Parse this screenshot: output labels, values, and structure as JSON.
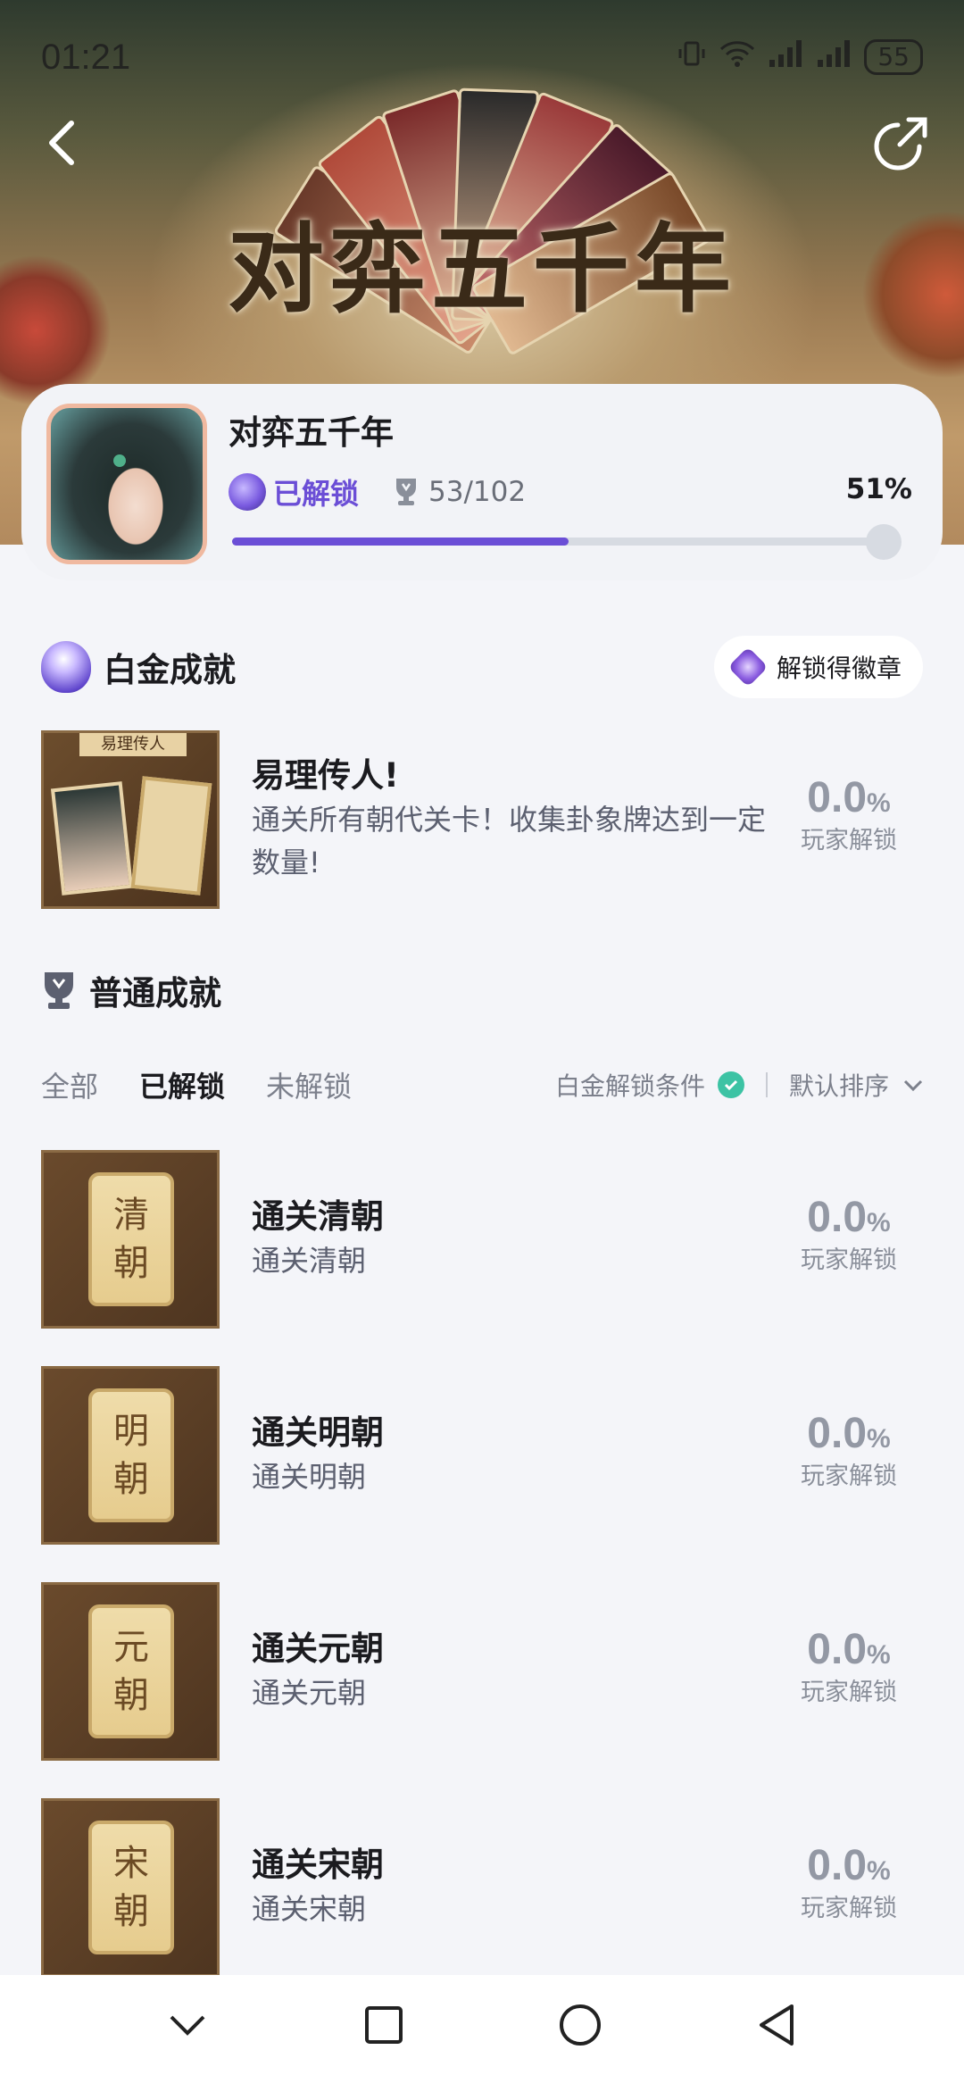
{
  "status_bar": {
    "time": "01:21",
    "battery": "55"
  },
  "hero": {
    "title": "对弈五千年"
  },
  "game": {
    "title": "对弈五千年",
    "unlocked_label": "已解锁",
    "trophy_count": "53/102",
    "percent_label": "51%",
    "progress": 0.51
  },
  "platinum": {
    "section_title": "白金成就",
    "badge_pill": "解锁得徽章",
    "thumb_banner": "易理传人",
    "item": {
      "name": "易理传人!",
      "desc": "通关所有朝代关卡！收集卦象牌达到一定数量!",
      "rate_value": "0.0",
      "rate_unit": "%",
      "rate_label": "玩家解锁"
    }
  },
  "common": {
    "section_title": "普通成就",
    "tabs": [
      {
        "label": "全部"
      },
      {
        "label": "已解锁"
      },
      {
        "label": "未解锁"
      }
    ],
    "filter_condition": "白金解锁条件",
    "sort_label": "默认排序",
    "items": [
      {
        "tablet": [
          "清",
          "朝"
        ],
        "name": "通关清朝",
        "desc": "通关清朝",
        "rate_value": "0.0",
        "rate_unit": "%",
        "rate_label": "玩家解锁"
      },
      {
        "tablet": [
          "明",
          "朝"
        ],
        "name": "通关明朝",
        "desc": "通关明朝",
        "rate_value": "0.0",
        "rate_unit": "%",
        "rate_label": "玩家解锁"
      },
      {
        "tablet": [
          "元",
          "朝"
        ],
        "name": "通关元朝",
        "desc": "通关元朝",
        "rate_value": "0.0",
        "rate_unit": "%",
        "rate_label": "玩家解锁"
      },
      {
        "tablet": [
          "宋",
          "朝"
        ],
        "name": "通关宋朝",
        "desc": "通关宋朝",
        "rate_value": "0.0",
        "rate_unit": "%",
        "rate_label": "玩家解锁"
      }
    ]
  },
  "colors": {
    "accent": "#6b4ed6",
    "check": "#3cc3a4",
    "page_bg": "#f4f5f9"
  },
  "icons": [
    "back-icon",
    "share-icon",
    "platinum-trophy-icon",
    "trophy-icon",
    "badge-icon",
    "check-icon",
    "chevron-down-icon"
  ]
}
